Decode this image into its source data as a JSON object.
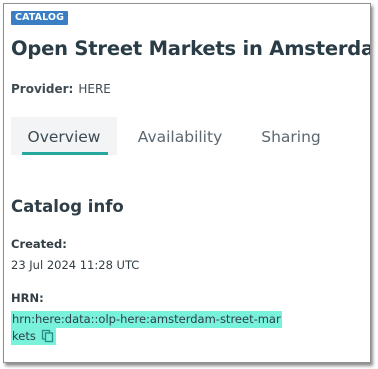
{
  "badge": "CATALOG",
  "title": "Open Street Markets in Amsterdam",
  "provider": {
    "label": "Provider:",
    "value": "HERE"
  },
  "tabs": [
    {
      "label": "Overview",
      "active": true
    },
    {
      "label": "Availability",
      "active": false
    },
    {
      "label": "Sharing",
      "active": false
    }
  ],
  "catalog_info": {
    "title": "Catalog info",
    "created_label": "Created:",
    "created_value": "23 Jul 2024 11:28 UTC",
    "hrn_label": "HRN:",
    "hrn_line1": "hrn:here:data::olp-here:amsterdam-street-mar",
    "hrn_line2": "kets",
    "copy_icon": "copy-icon"
  },
  "colors": {
    "badge": "#3a7fc3",
    "accent": "#27a89e",
    "highlight": "#79f2dc",
    "title": "#2a3d47"
  }
}
